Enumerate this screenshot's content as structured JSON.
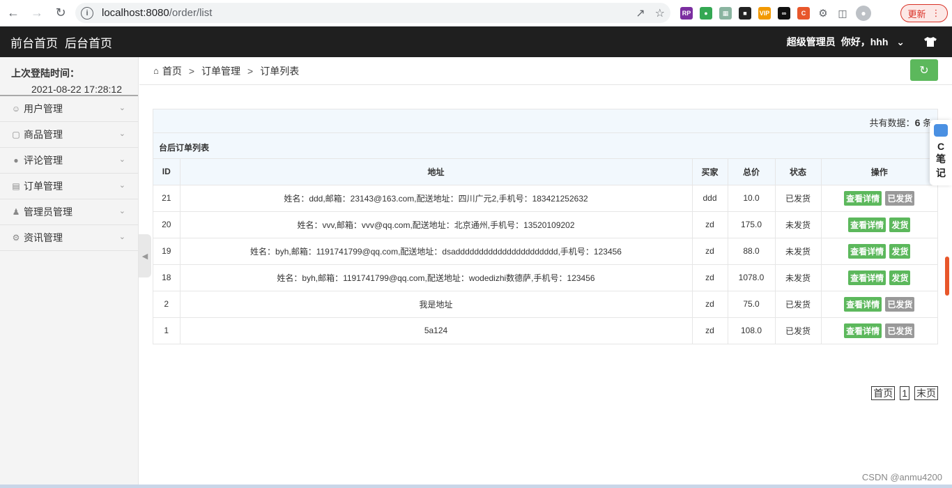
{
  "browser": {
    "url_host": "localhost:8080",
    "url_path": "/order/list",
    "update_label": "更新"
  },
  "header": {
    "links": [
      "前台首页",
      "后台首页"
    ],
    "role": "超级管理员",
    "greeting": "你好，hhh"
  },
  "sidebar": {
    "login_label": "上次登陆时间：",
    "login_time": "2021-08-22 17:28:12",
    "items": [
      {
        "label": "用户管理",
        "icon": "user-icon"
      },
      {
        "label": "商品管理",
        "icon": "bag-icon"
      },
      {
        "label": "评论管理",
        "icon": "comment-icon"
      },
      {
        "label": "订单管理",
        "icon": "order-icon"
      },
      {
        "label": "管理员管理",
        "icon": "admin-icon"
      },
      {
        "label": "资讯管理",
        "icon": "gear-icon"
      }
    ]
  },
  "breadcrumb": [
    "首页",
    "订单管理",
    "订单列表"
  ],
  "main": {
    "total_label": "共有数据：",
    "total_count": "6",
    "total_suffix": "条",
    "panel_title": "台后订单列表",
    "columns": [
      "ID",
      "地址",
      "买家",
      "总价",
      "状态",
      "操作"
    ],
    "detail_label": "查看详情",
    "rows": [
      {
        "id": "21",
        "address": "姓名：ddd,邮箱：23143@163.com,配送地址：四川广元2,手机号：183421252632",
        "buyer": "ddd",
        "total": "10.0",
        "status": "已发货",
        "action": "已发货"
      },
      {
        "id": "20",
        "address": "姓名：vvv,邮箱：vvv@qq.com,配送地址：北京通州,手机号：13520109202",
        "buyer": "zd",
        "total": "175.0",
        "status": "未发货",
        "action": "发货"
      },
      {
        "id": "19",
        "address": "姓名：byh,邮箱：1191741799@qq.com,配送地址：dsadddddddddddddddddddddd,手机号：123456",
        "buyer": "zd",
        "total": "88.0",
        "status": "未发货",
        "action": "发货"
      },
      {
        "id": "18",
        "address": "姓名：byh,邮箱：1191741799@qq.com,配送地址：wodedizhi数德萨,手机号：123456",
        "buyer": "zd",
        "total": "1078.0",
        "status": "未发货",
        "action": "发货"
      },
      {
        "id": "2",
        "address": "我是地址",
        "buyer": "zd",
        "total": "75.0",
        "status": "已发货",
        "action": "已发货"
      },
      {
        "id": "1",
        "address": "5a124",
        "buyer": "zd",
        "total": "108.0",
        "status": "已发货",
        "action": "已发货"
      }
    ]
  },
  "pagination": {
    "first": "首页",
    "current": "1",
    "last": "末页"
  },
  "note_widget": {
    "letter": "C",
    "line1": "笔",
    "line2": "记"
  },
  "watermark": "CSDN @anmu4200"
}
